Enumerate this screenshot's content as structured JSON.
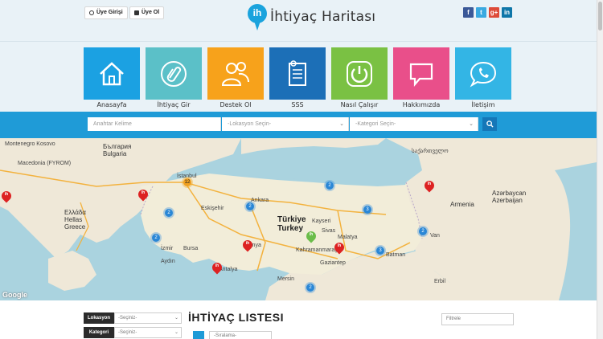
{
  "header": {
    "login_label": "Üye Girişi",
    "register_label": "Üye Ol",
    "logo_mark": "ih",
    "logo_text": "İhtiyaç Haritası",
    "social": [
      {
        "name": "facebook-icon",
        "glyph": "f",
        "color": "#3b5998"
      },
      {
        "name": "twitter-icon",
        "glyph": "t",
        "color": "#3aa9e0"
      },
      {
        "name": "google-plus-icon",
        "glyph": "g+",
        "color": "#dd4b39"
      },
      {
        "name": "linkedin-icon",
        "glyph": "in",
        "color": "#0e76a8"
      }
    ]
  },
  "tiles": [
    {
      "label": "Anasayfa",
      "color": "#1ba1e2",
      "icon": "home-icon"
    },
    {
      "label": "İhtiyaç Gir",
      "color": "#5bc0c8",
      "icon": "paperclip-icon"
    },
    {
      "label": "Destek Ol",
      "color": "#f7a21b",
      "icon": "users-icon"
    },
    {
      "label": "SSS",
      "color": "#1c6fb7",
      "icon": "document-icon"
    },
    {
      "label": "Nasıl Çalışır",
      "color": "#7ac143",
      "icon": "power-icon"
    },
    {
      "label": "Hakkımızda",
      "color": "#e94f8a",
      "icon": "chat-icon"
    },
    {
      "label": "İletişim",
      "color": "#33b5e5",
      "icon": "phone-chat-icon"
    }
  ],
  "search": {
    "keyword_placeholder": "Anahtar Kelime",
    "location_placeholder": "-Lokasyon Seçin-",
    "category_placeholder": "-Kategori Seçin-"
  },
  "map": {
    "labels": {
      "montenegro": "Montenegro Kosovo",
      "macedonia": "Macedonia (FYROM)",
      "bulgaria": "България Bulgaria",
      "hellas": "Ελλάδα Hellas Greece",
      "istanbul": "İstanbul",
      "turkey": "Türkiye Turkey",
      "armenia": "Armenia",
      "azerbaijan": "Azərbaycan Azerbaijan",
      "georgia": "საქართველო",
      "ankara": "Ankara",
      "bursa": "Bursa",
      "izmir": "İzmir",
      "konya": "Konya",
      "kayseri": "Kayseri",
      "sivas": "Sivas",
      "malatya": "Malatya",
      "gaziantep": "Gaziantep",
      "mersin": "Mersin",
      "erbil": "Erbil",
      "eskisehir": "Eskişehir",
      "aydin": "Aydın",
      "antalya": "Antalya",
      "batman": "Batman",
      "van": "Van",
      "kahramanmaras": "Kahramanmaraş"
    },
    "google_logo": "Google",
    "clusters": [
      {
        "count": "12",
        "color": "orange"
      },
      {
        "count": "2",
        "color": "blue"
      },
      {
        "count": "2",
        "color": "blue"
      },
      {
        "count": "2",
        "color": "blue"
      },
      {
        "count": "3",
        "color": "blue"
      },
      {
        "count": "2",
        "color": "blue"
      },
      {
        "count": "2",
        "color": "blue"
      },
      {
        "count": "3",
        "color": "blue"
      },
      {
        "count": "2",
        "color": "blue"
      }
    ],
    "pin_text": "ih"
  },
  "filters": {
    "location_label": "Lokasyon",
    "location_value": "-Seçiniz-",
    "category_label": "Kategori",
    "category_value": "-Seçiniz-"
  },
  "list": {
    "title": "İHTİYAÇ LISTESI",
    "filter_placeholder": "Filtrele",
    "sort_value": "-Sıralama-"
  }
}
